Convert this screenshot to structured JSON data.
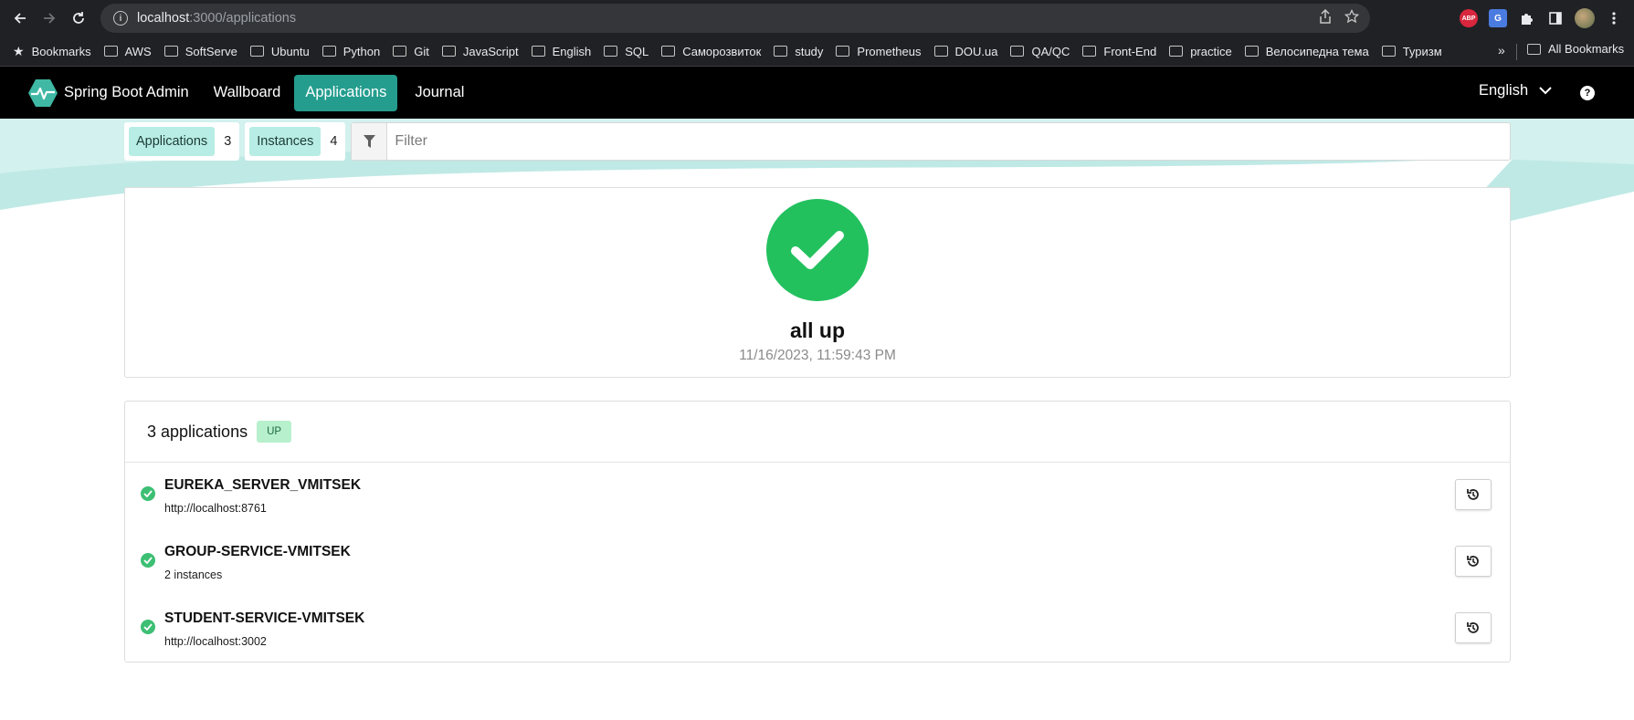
{
  "browser": {
    "url_host": "localhost",
    "url_path": ":3000/applications",
    "bookmarks_label": "Bookmarks",
    "bookmark_folders": [
      "AWS",
      "SoftServe",
      "Ubuntu",
      "Python",
      "Git",
      "JavaScript",
      "English",
      "SQL",
      "Саморозвиток",
      "study",
      "Prometheus",
      "DOU.ua",
      "QA/QC",
      "Front-End",
      "practice",
      "Велосипедна тема",
      "Туризм"
    ],
    "more_label": "»",
    "all_bookmarks": "All Bookmarks",
    "ext_abp": "ABP",
    "ext_translate": "G"
  },
  "nav": {
    "brand": "Spring Boot Admin",
    "items": [
      "Wallboard",
      "Applications",
      "Journal"
    ],
    "active": "Applications",
    "language": "English",
    "help": "?"
  },
  "filter": {
    "applications_label": "Applications",
    "applications_count": "3",
    "instances_label": "Instances",
    "instances_count": "4",
    "placeholder": "Filter"
  },
  "status": {
    "title": "all up",
    "timestamp": "11/16/2023, 11:59:43 PM"
  },
  "apps": {
    "count_label": "3 applications",
    "badge": "UP",
    "items": [
      {
        "name": "EUREKA_SERVER_VMITSEK",
        "detail": "http://localhost:8761"
      },
      {
        "name": "GROUP-SERVICE-VMITSEK",
        "detail": "2 instances"
      },
      {
        "name": "STUDENT-SERVICE-VMITSEK",
        "detail": "http://localhost:3002"
      }
    ]
  },
  "colors": {
    "accent": "#249d8e",
    "up_green": "#22c15e",
    "badge_bg": "#b8ede5"
  },
  "icons": [
    "back-icon",
    "forward-icon",
    "reload-icon",
    "info-icon",
    "share-icon",
    "star-icon",
    "puzzle-icon",
    "side-panel-icon",
    "menu-icon",
    "folder-icon",
    "logo-icon",
    "chevron-down-icon",
    "help-icon",
    "filter-icon",
    "check-icon",
    "history-icon"
  ]
}
